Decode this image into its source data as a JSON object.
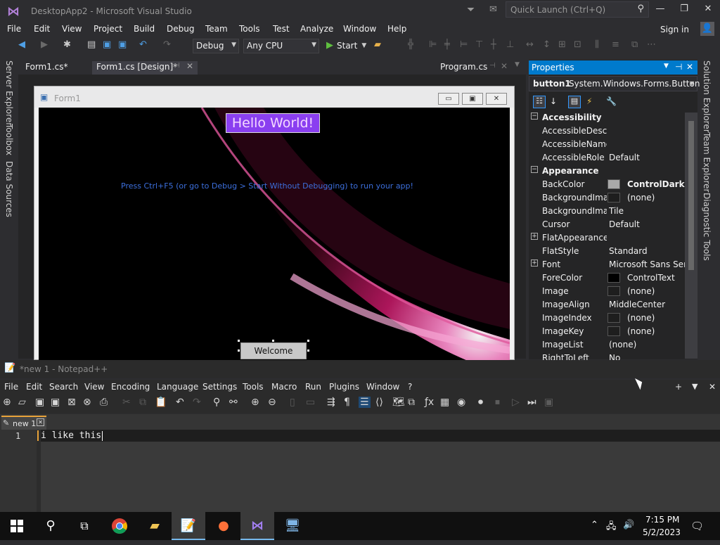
{
  "vs": {
    "title": "DesktopApp2 - Microsoft Visual Studio",
    "quick_launch_placeholder": "Quick Launch (Ctrl+Q)",
    "menu": [
      "File",
      "Edit",
      "View",
      "Project",
      "Build",
      "Debug",
      "Team",
      "Tools",
      "Test",
      "Analyze",
      "Window",
      "Help"
    ],
    "sign_in": "Sign in",
    "toolbar": {
      "config": "Debug",
      "platform": "Any CPU",
      "start": "Start"
    },
    "side_tabs_left": [
      "Server Explorer",
      "Toolbox",
      "Data Sources"
    ],
    "side_tabs_right": [
      "Solution Explorer",
      "Team Explorer",
      "Diagnostic Tools"
    ],
    "doc_tabs": [
      "Form1.cs*",
      "Form1.cs [Design]*",
      "Program.cs"
    ],
    "form": {
      "title": "Form1",
      "hello_label": "Hello World!",
      "hint_label": "Press Ctrl+F5 (or go to Debug > Start Without Debugging) to run your app!",
      "button_text": "Welcome"
    },
    "properties": {
      "header": "Properties",
      "object_name": "button1",
      "object_type": "System.Windows.Forms.Button",
      "rows": [
        {
          "kind": "cat",
          "name": "Accessibility"
        },
        {
          "kind": "prop",
          "name": "AccessibleDescription",
          "display": "AccessibleDescri",
          "value": ""
        },
        {
          "kind": "prop",
          "name": "AccessibleName",
          "display": "AccessibleName",
          "value": ""
        },
        {
          "kind": "prop",
          "name": "AccessibleRole",
          "display": "AccessibleRole",
          "value": "Default"
        },
        {
          "kind": "cat",
          "name": "Appearance"
        },
        {
          "kind": "prop",
          "name": "BackColor",
          "display": "BackColor",
          "value": "ControlDark",
          "swatch": "#a9a9a9",
          "bold": true
        },
        {
          "kind": "prop",
          "name": "BackgroundImage",
          "display": "BackgroundImag",
          "value": "(none)",
          "swatch": "#1e1e1e"
        },
        {
          "kind": "prop",
          "name": "BackgroundImageLayout",
          "display": "BackgroundImag",
          "value": "Tile"
        },
        {
          "kind": "prop",
          "name": "Cursor",
          "display": "Cursor",
          "value": "Default"
        },
        {
          "kind": "expand",
          "name": "FlatAppearance",
          "display": "FlatAppearance",
          "value": ""
        },
        {
          "kind": "prop",
          "name": "FlatStyle",
          "display": "FlatStyle",
          "value": "Standard"
        },
        {
          "kind": "expand",
          "name": "Font",
          "display": "Font",
          "value": "Microsoft Sans Serif,"
        },
        {
          "kind": "prop",
          "name": "ForeColor",
          "display": "ForeColor",
          "value": "ControlText",
          "swatch": "#000000"
        },
        {
          "kind": "prop",
          "name": "Image",
          "display": "Image",
          "value": "(none)",
          "swatch": "#1e1e1e"
        },
        {
          "kind": "prop",
          "name": "ImageAlign",
          "display": "ImageAlign",
          "value": "MiddleCenter"
        },
        {
          "kind": "prop",
          "name": "ImageIndex",
          "display": "ImageIndex",
          "value": "(none)",
          "swatch": "#1e1e1e"
        },
        {
          "kind": "prop",
          "name": "ImageKey",
          "display": "ImageKey",
          "value": "(none)",
          "swatch": "#1e1e1e"
        },
        {
          "kind": "prop",
          "name": "ImageList",
          "display": "ImageList",
          "value": "(none)"
        },
        {
          "kind": "prop",
          "name": "RightToLeft",
          "display": "RightToLeft",
          "value": "No"
        }
      ]
    }
  },
  "notepad": {
    "title": "*new 1 - Notepad++",
    "menu": [
      "File",
      "Edit",
      "Search",
      "View",
      "Encoding",
      "Language",
      "Settings",
      "Tools",
      "Macro",
      "Run",
      "Plugins",
      "Window",
      "?"
    ],
    "tab": "new 1",
    "line_number": "1",
    "text": "i like this"
  },
  "taskbar": {
    "time": "7:15 PM",
    "date": "5/2/2023"
  },
  "colors": {
    "accent": "#007acc",
    "form_label": "#8a3ff0",
    "hint": "#3c6fdc"
  }
}
